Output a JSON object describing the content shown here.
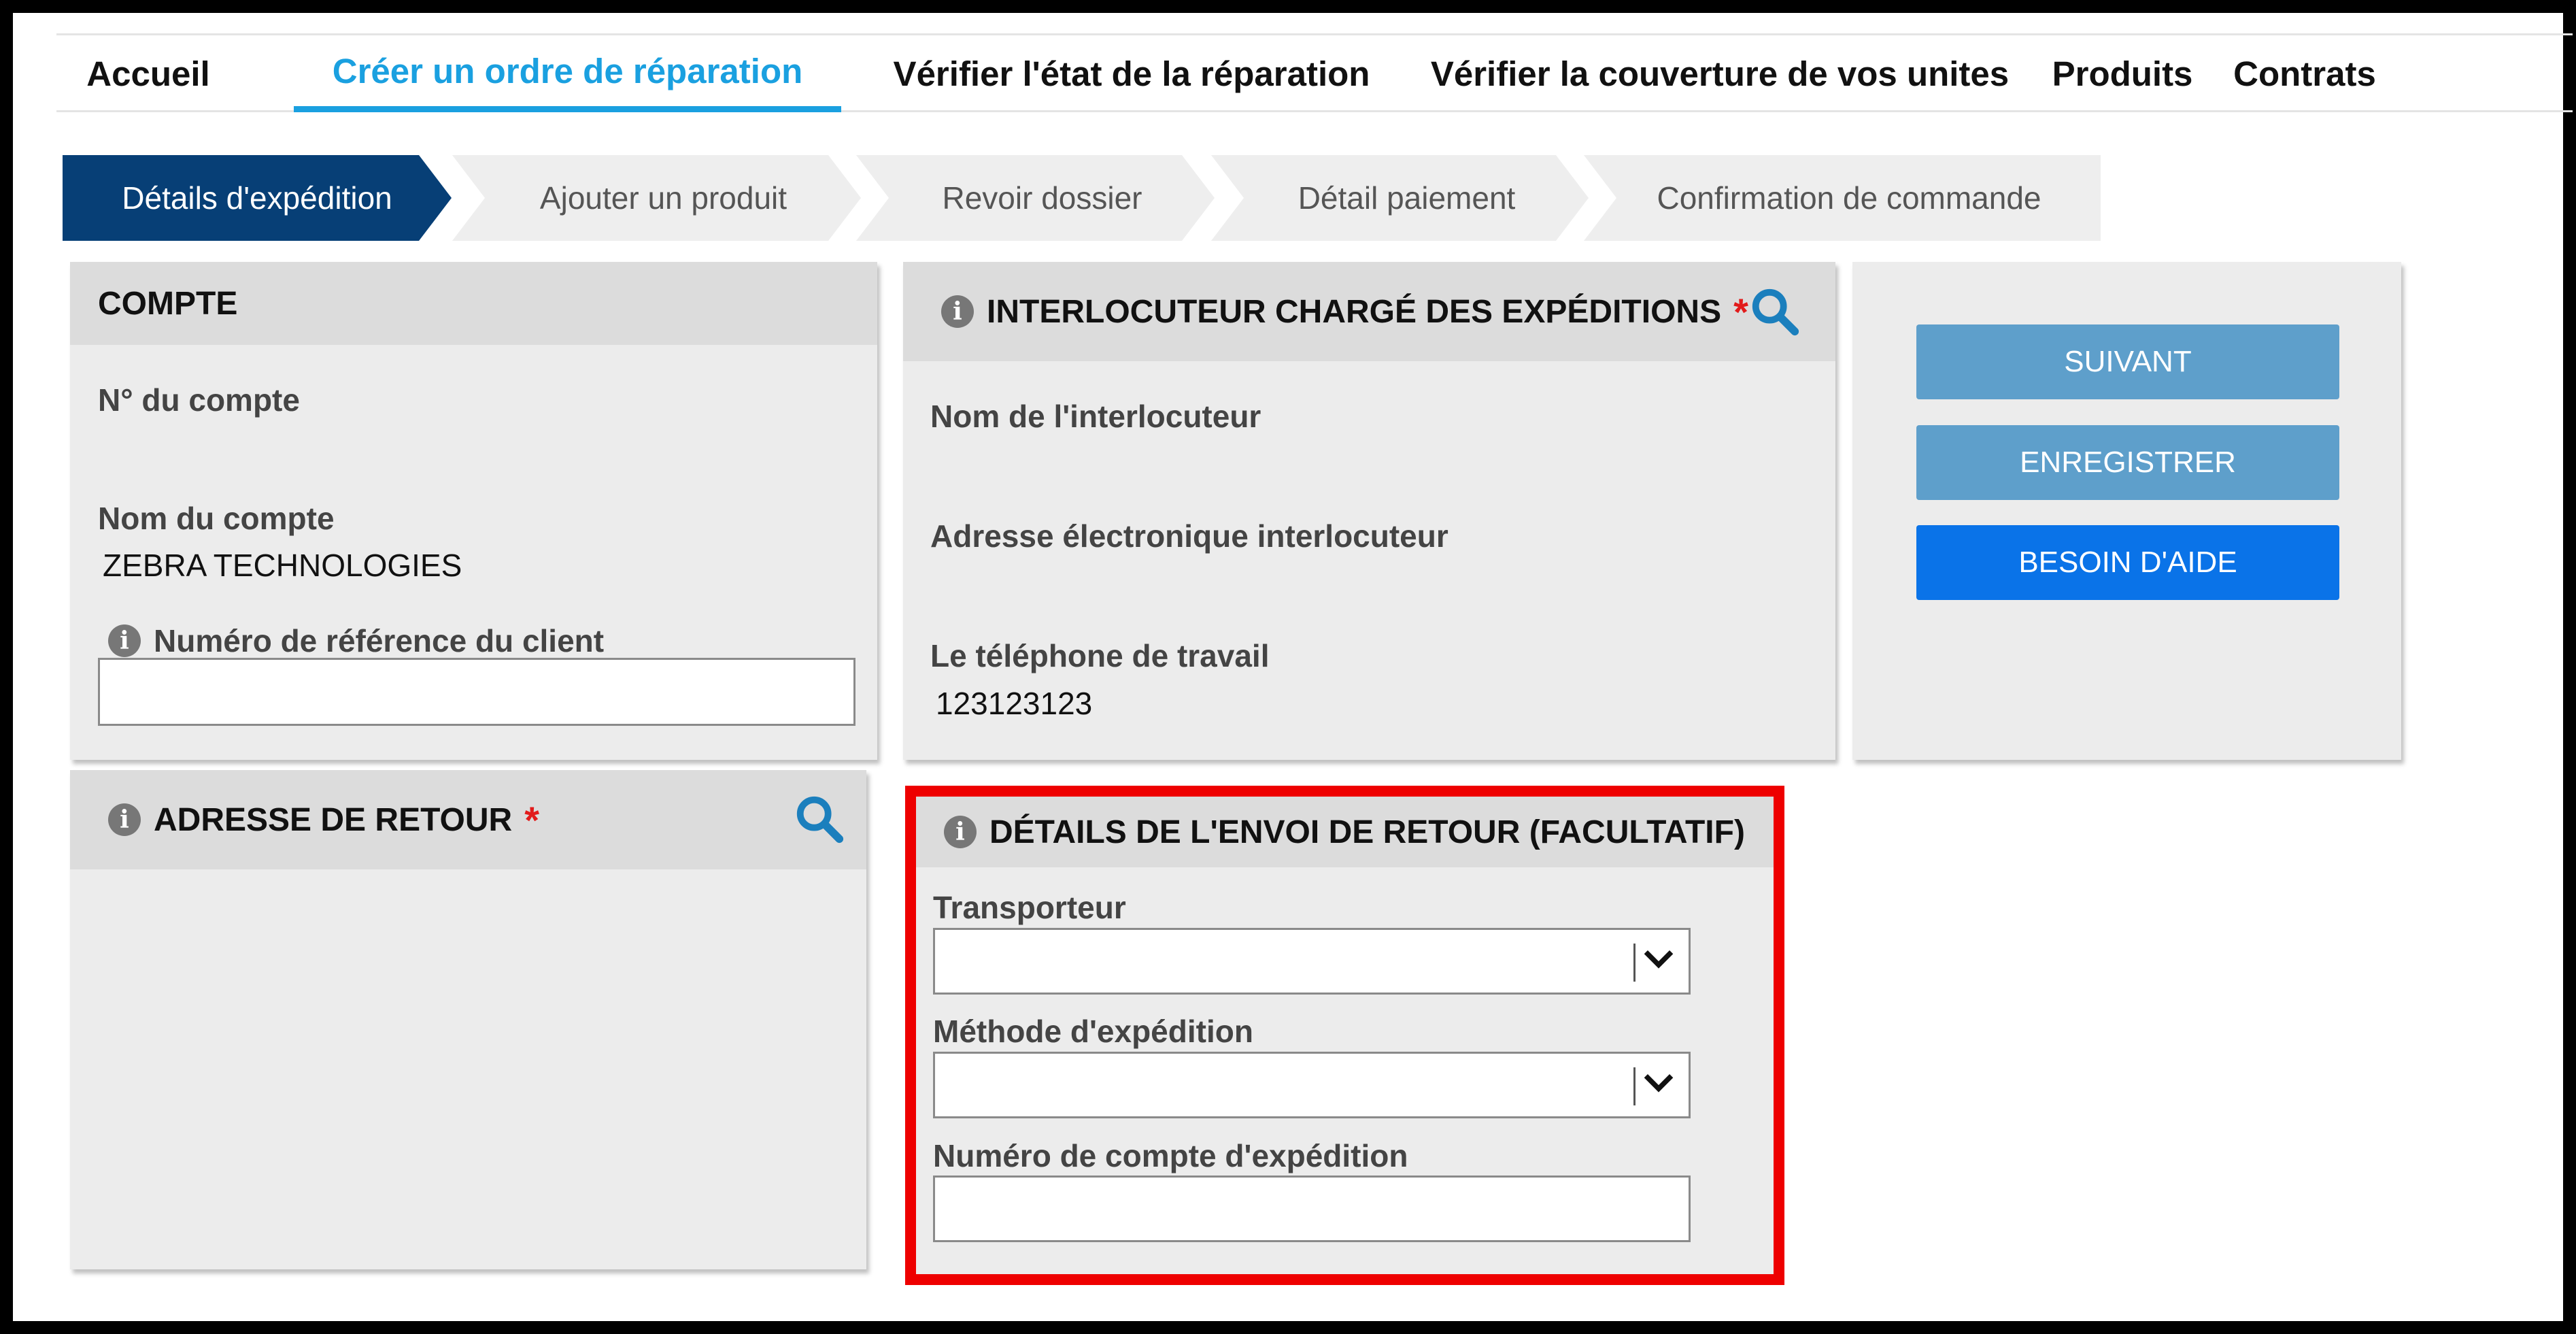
{
  "nav": {
    "items": [
      "Accueil",
      "Créer un ordre de réparation",
      "Vérifier l'état de la réparation",
      "Vérifier la couverture de vos unites",
      "Produits",
      "Contrats"
    ],
    "active_index": 1
  },
  "steps": [
    "Détails d'expédition",
    "Ajouter un produit",
    "Revoir dossier",
    "Détail paiement",
    "Confirmation de commande"
  ],
  "account": {
    "title": "COMPTE",
    "number_label": "N° du compte",
    "name_label": "Nom du compte",
    "name_value": "ZEBRA TECHNOLOGIES",
    "ref_label": "Numéro de référence du client",
    "ref_value": ""
  },
  "contact": {
    "title": "INTERLOCUTEUR CHARGÉ DES EXPÉDITIONS",
    "required_mark": "*",
    "name_label": "Nom de l'interlocuteur",
    "email_label": "Adresse électronique interlocuteur",
    "phone_label": "Le téléphone de travail",
    "phone_value": "123123123"
  },
  "actions": {
    "next": "SUIVANT",
    "save": "ENREGISTRER",
    "help": "BESOIN D'AIDE"
  },
  "return_address": {
    "title": "ADRESSE DE RETOUR",
    "required_mark": "*"
  },
  "return_shipment": {
    "title": "DÉTAILS DE L'ENVOI DE RETOUR (FACULTATIF)",
    "carrier_label": "Transporteur",
    "carrier_value": "",
    "method_label": "Méthode d'expédition",
    "method_value": "",
    "account_label": "Numéro de compte d'expédition",
    "account_value": ""
  },
  "colors": {
    "accent": "#1aa0e0",
    "active_step": "#073f76",
    "button_soft": "#5e9fcb",
    "button_strong": "#0a73e8",
    "required": "#e21b1b",
    "highlight": "#ee0000"
  },
  "icons": {
    "info": "info-icon",
    "search": "search-icon",
    "dropdown": "chevron-down-icon"
  }
}
